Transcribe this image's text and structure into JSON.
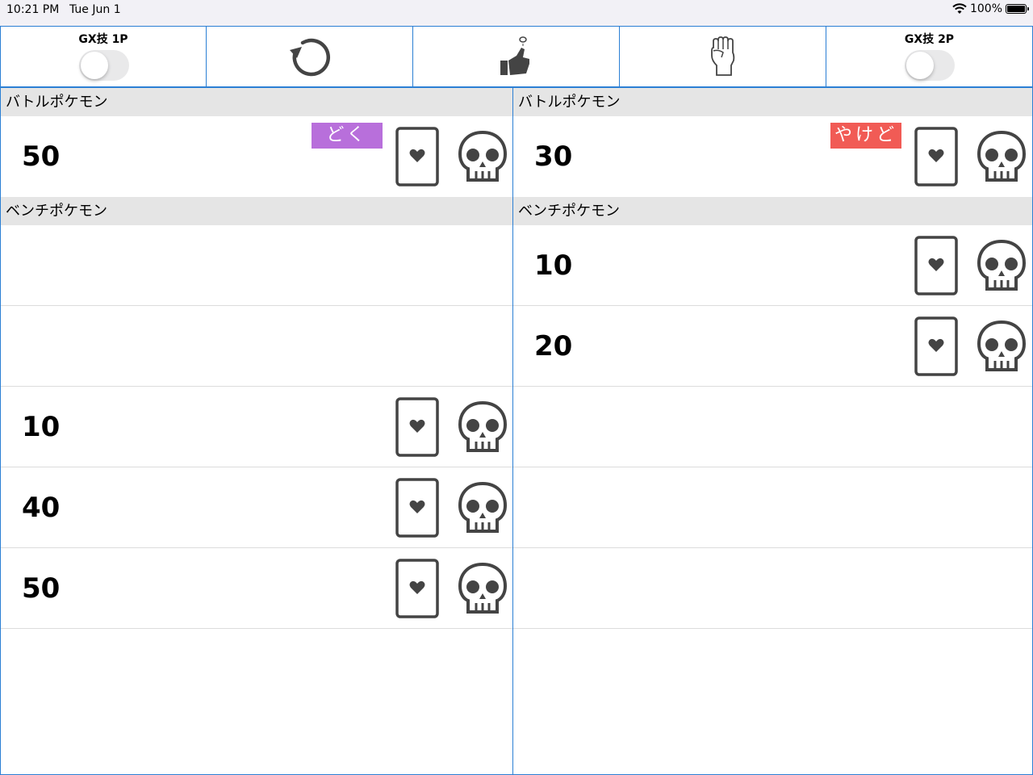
{
  "status_bar": {
    "time": "10:21 PM",
    "date": "Tue Jun 1",
    "battery": "100%"
  },
  "toolbar": {
    "gx_1p_label": "GX技 1P",
    "gx_2p_label": "GX技 2P",
    "gx_1p_on": false,
    "gx_2p_on": false,
    "icons": [
      "reset-icon",
      "coin-flip-icon",
      "fist-icon"
    ]
  },
  "player1": {
    "battle_header": "バトルポケモン",
    "bench_header": "ベンチポケモン",
    "battle": {
      "hp": "50",
      "status": "どく",
      "status_color": "#b86fdb"
    },
    "bench": [
      {
        "hp": ""
      },
      {
        "hp": ""
      },
      {
        "hp": "10"
      },
      {
        "hp": "40"
      },
      {
        "hp": "50"
      }
    ]
  },
  "player2": {
    "battle_header": "バトルポケモン",
    "bench_header": "ベンチポケモン",
    "battle": {
      "hp": "30",
      "status": "やけど",
      "status_color": "#f15b55"
    },
    "bench": [
      {
        "hp": "10"
      },
      {
        "hp": "20"
      },
      {
        "hp": ""
      },
      {
        "hp": ""
      },
      {
        "hp": ""
      }
    ]
  },
  "colors": {
    "accent_border": "#2b7fd4",
    "header_bg": "#e5e5e5",
    "icon_gray": "#555555"
  }
}
